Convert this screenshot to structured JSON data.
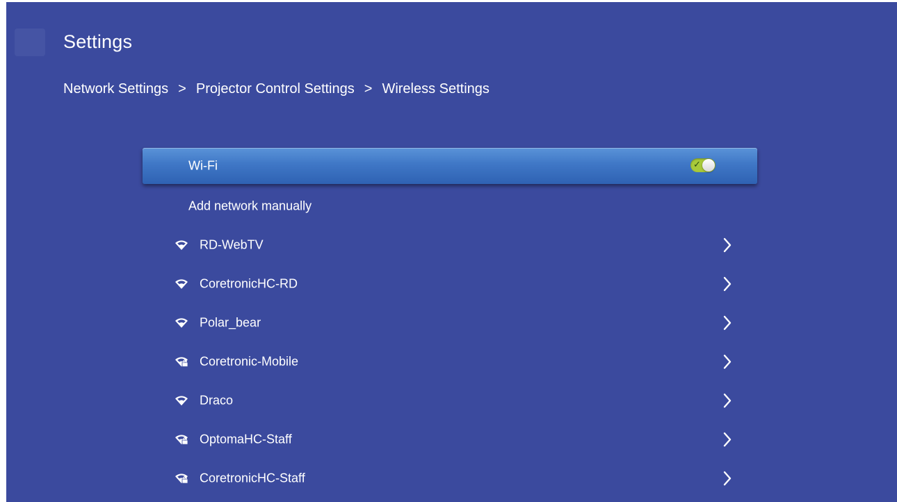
{
  "header": {
    "title": "Settings"
  },
  "breadcrumb": {
    "items": [
      "Network Settings",
      "Projector Control Settings",
      "Wireless Settings"
    ],
    "separator": ">"
  },
  "wifi_toggle": {
    "label": "Wi-Fi",
    "state": "on",
    "accent_color": "#a8c93a"
  },
  "add_network": {
    "label": "Add network manually"
  },
  "networks": [
    {
      "name": "RD-WebTV",
      "secured": false,
      "icon": "wifi-icon"
    },
    {
      "name": "CoretronicHC-RD",
      "secured": false,
      "icon": "wifi-icon"
    },
    {
      "name": "Polar_bear",
      "secured": false,
      "icon": "wifi-icon"
    },
    {
      "name": "Coretronic-Mobile",
      "secured": true,
      "icon": "wifi-lock-icon"
    },
    {
      "name": "Draco",
      "secured": false,
      "icon": "wifi-icon"
    },
    {
      "name": "OptomaHC-Staff",
      "secured": true,
      "icon": "wifi-lock-icon"
    },
    {
      "name": "CoretronicHC-Staff",
      "secured": true,
      "icon": "wifi-lock-icon"
    }
  ],
  "colors": {
    "background": "#3b4a9e",
    "selection": "#3f77c6",
    "text": "#ffffff"
  }
}
